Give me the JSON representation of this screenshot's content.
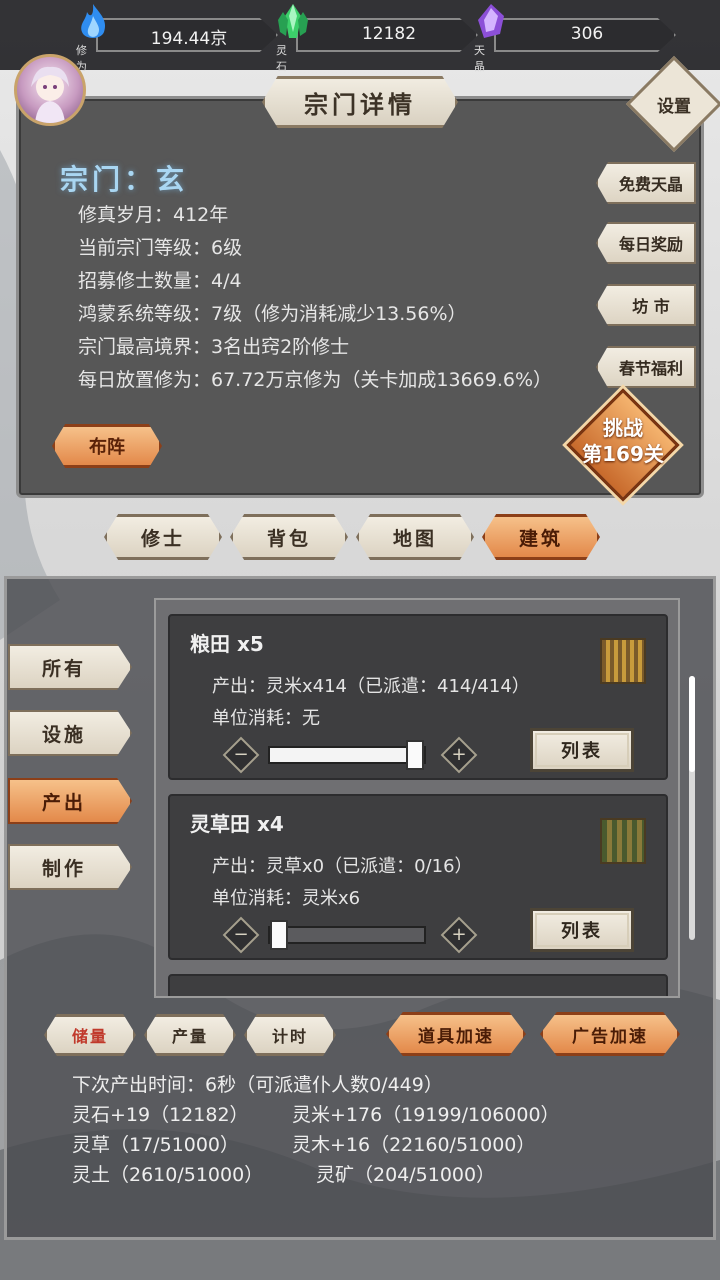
{
  "resources": [
    {
      "icon": "blue-flame-icon",
      "label": "修为",
      "value": "194.44京"
    },
    {
      "icon": "green-crystal-icon",
      "label": "灵石",
      "value": "12182"
    },
    {
      "icon": "purple-crystal-icon",
      "label": "天晶",
      "value": "306"
    }
  ],
  "panel": {
    "title": "宗门详情",
    "settings_label": "设置",
    "sect_name": "宗门：玄",
    "info": [
      "修真岁月：412年",
      "当前宗门等级：6级",
      "招募修士数量：4/4",
      "鸿蒙系统等级：7级（修为消耗减少13.56%）",
      "宗门最高境界：3名出窍2阶修士",
      "每日放置修为：67.72万京修为（关卡加成13669.6%）"
    ],
    "side_buttons": [
      "免费天晶",
      "每日奖励",
      "坊 市",
      "春节福利"
    ],
    "formation_label": "布阵",
    "challenge": {
      "line1": "挑战",
      "line2": "第169关"
    }
  },
  "tabs": [
    {
      "label": "修士",
      "active": false
    },
    {
      "label": "背包",
      "active": false
    },
    {
      "label": "地图",
      "active": false
    },
    {
      "label": "建筑",
      "active": true
    }
  ],
  "categories": [
    {
      "label": "所有",
      "active": false
    },
    {
      "label": "设施",
      "active": false
    },
    {
      "label": "产出",
      "active": true
    },
    {
      "label": "制作",
      "active": false
    }
  ],
  "buildings": [
    {
      "name": "粮田 x5",
      "output": "产出：灵米x414（已派遣：414/414）",
      "cost": "单位消耗：无",
      "assign_fraction": 1.0,
      "list_label": "列表"
    },
    {
      "name": "灵草田 x4",
      "output": "产出：灵草x0（已派遣：0/16）",
      "cost": "单位消耗：灵米x6",
      "assign_fraction": 0.0,
      "list_label": "列表"
    }
  ],
  "actions": {
    "storage": "储量",
    "production": "产量",
    "timer": "计时",
    "item_boost": "道具加速",
    "ad_boost": "广告加速"
  },
  "stats": {
    "next_output": "下次产出时间：6秒（可派遣仆人数0/449）",
    "lingshi": "灵石+19（12182）",
    "lingmi": "灵米+176（19199/106000）",
    "lingcao": "灵草（17/51000）",
    "lingmu": "灵木+16（22160/51000）",
    "lingtu": "灵土（2610/51000）",
    "lingkuang": "灵矿（204/51000）"
  }
}
